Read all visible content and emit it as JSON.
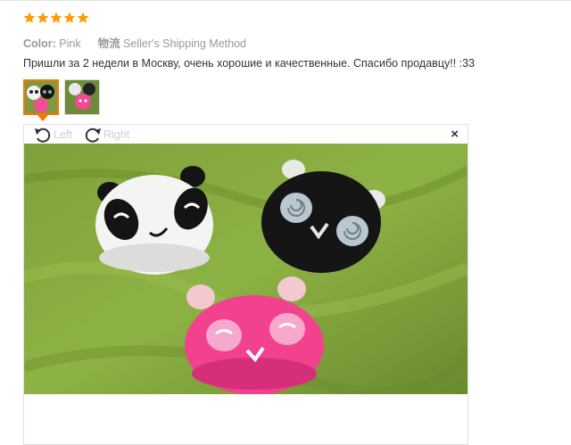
{
  "review": {
    "rating": 5,
    "rating_max": 5,
    "star_color": "#ff9a00",
    "color_label": "Color:",
    "color_value": "Pink",
    "logistics_label": "物流",
    "logistics_value": "Seller's Shipping Method",
    "text": "Пришли за 2 недели в Москву, очень хорошие и качественные. Спасибо продавцу!! :33"
  },
  "thumbnails": {
    "count": 2,
    "selected_index": 0,
    "accent": "#ff7300"
  },
  "viewer": {
    "rotate_left_label": "Left",
    "rotate_right_label": "Right",
    "close_symbol": "×",
    "photo_subject": [
      "white panda case",
      "black panda case",
      "pink panda case"
    ]
  }
}
